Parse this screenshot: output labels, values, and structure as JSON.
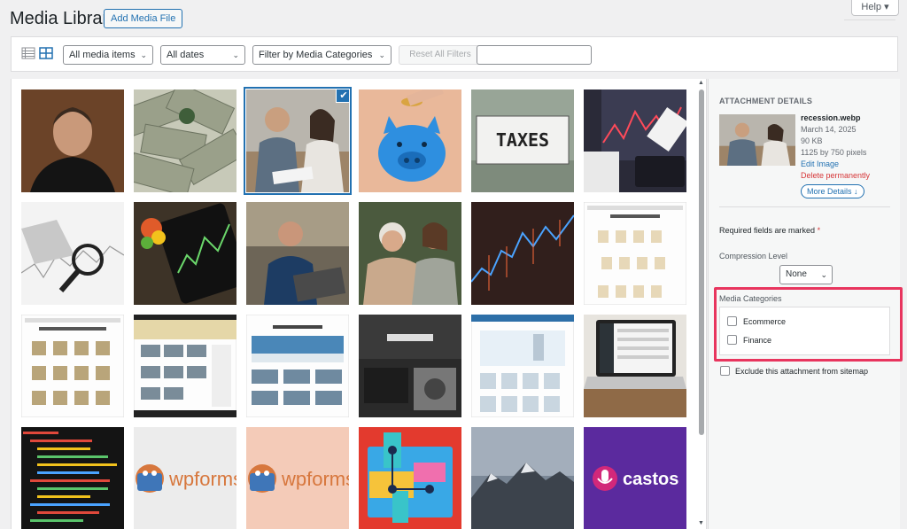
{
  "header": {
    "title": "Media Library",
    "add_button": "Add Media File",
    "help": "Help"
  },
  "toolbar": {
    "filter_type": "All media items",
    "filter_date": "All dates",
    "filter_category": "Filter by Media Categories",
    "reset_label": "Reset All Filters",
    "search_placeholder": ""
  },
  "grid": {
    "items": [
      {
        "name": "portrait-man"
      },
      {
        "name": "dollar-bills"
      },
      {
        "name": "recession-couple"
      },
      {
        "name": "piggy-bank"
      },
      {
        "name": "taxes-sign"
      },
      {
        "name": "stock-report"
      },
      {
        "name": "magnifier-chart"
      },
      {
        "name": "tablet-chart"
      },
      {
        "name": "man-laptop"
      },
      {
        "name": "women-talking"
      },
      {
        "name": "stock-graph"
      },
      {
        "name": "product-page-1"
      },
      {
        "name": "product-page-2"
      },
      {
        "name": "website-mock-1"
      },
      {
        "name": "travel-site"
      },
      {
        "name": "tattoo-site"
      },
      {
        "name": "product-page-3"
      },
      {
        "name": "laptop-desk"
      },
      {
        "name": "code-editor"
      },
      {
        "name": "wpforms-logo-gray"
      },
      {
        "name": "wpforms-logo-peach"
      },
      {
        "name": "map-illustration"
      },
      {
        "name": "mountains"
      },
      {
        "name": "castos-logo"
      }
    ],
    "logo_text_wpforms": "wpforms",
    "logo_text_castos": "castos",
    "taxes_text": "TAXES"
  },
  "details": {
    "heading": "ATTACHMENT DETAILS",
    "filename": "recession.webp",
    "date": "March 14, 2025",
    "size": "90 KB",
    "dimensions": "1125 by 750 pixels",
    "edit_link": "Edit Image",
    "delete_link": "Delete permanently",
    "more_details": "More Details ↓",
    "required_note": "Required fields are marked",
    "required_star": "*",
    "compression_label": "Compression Level",
    "compression_value": "None",
    "media_categories_label": "Media Categories",
    "categories": [
      "Ecommerce",
      "Finance"
    ],
    "exclude_label": "Exclude this attachment from sitemap"
  },
  "colors": {
    "accent": "#2271b1",
    "highlight": "#e8355e",
    "danger": "#d63638"
  }
}
